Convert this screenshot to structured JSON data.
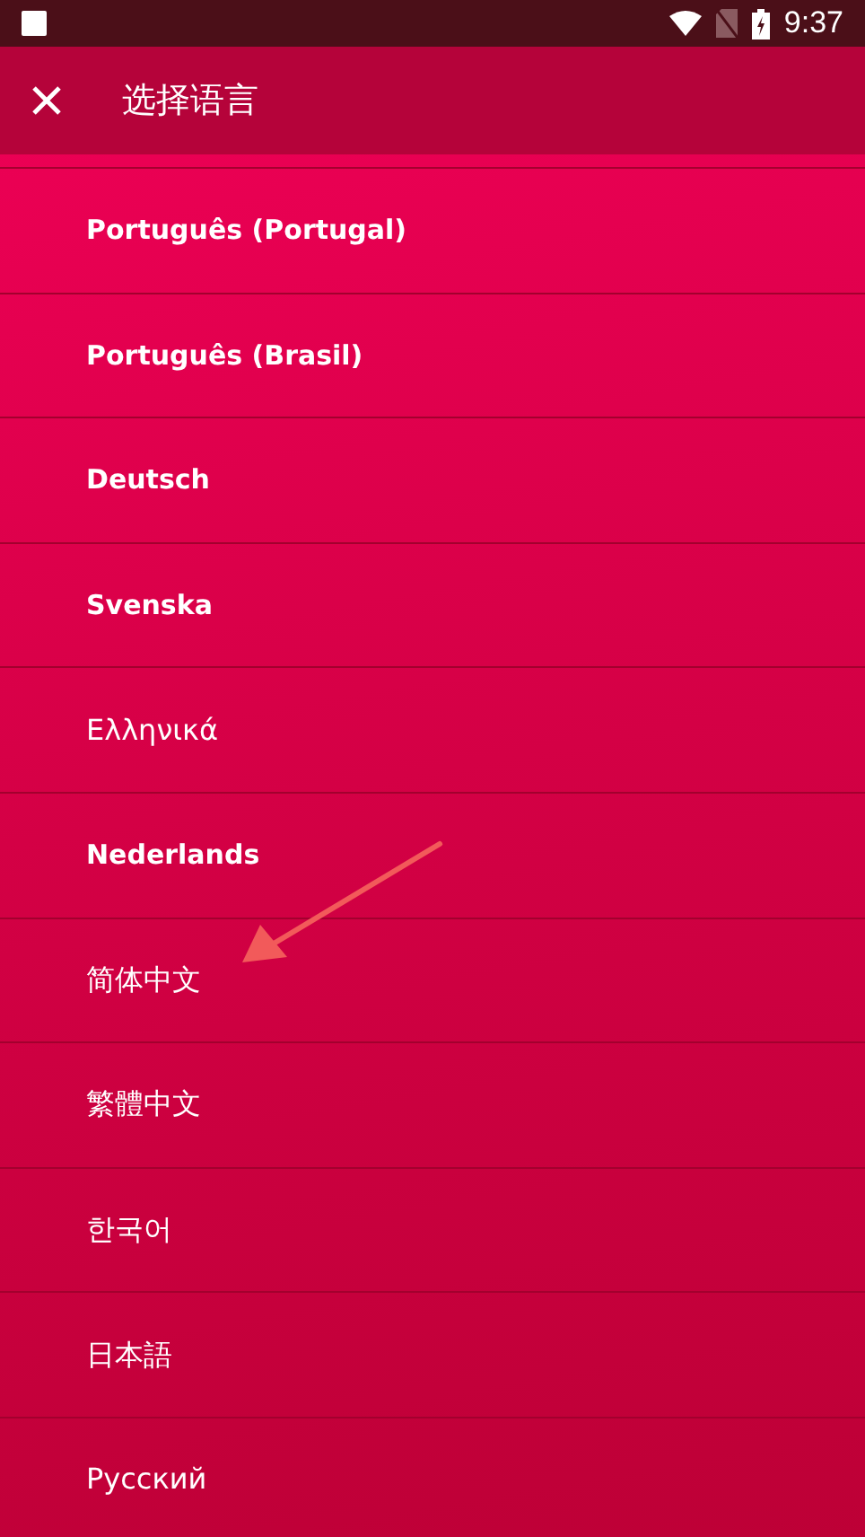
{
  "status_bar": {
    "time": "9:37"
  },
  "app_bar": {
    "title": "选择语言"
  },
  "languages": [
    {
      "label": "Português (Portugal)",
      "bold": true
    },
    {
      "label": "Português (Brasil)",
      "bold": true
    },
    {
      "label": "Deutsch",
      "bold": true
    },
    {
      "label": "Svenska",
      "bold": true
    },
    {
      "label": "Ελληνικά",
      "bold": false
    },
    {
      "label": "Nederlands",
      "bold": true
    },
    {
      "label": "简体中文",
      "bold": false
    },
    {
      "label": "繁體中文",
      "bold": false
    },
    {
      "label": "한국어",
      "bold": false
    },
    {
      "label": "日本語",
      "bold": false
    },
    {
      "label": "Русский",
      "bold": false
    }
  ]
}
